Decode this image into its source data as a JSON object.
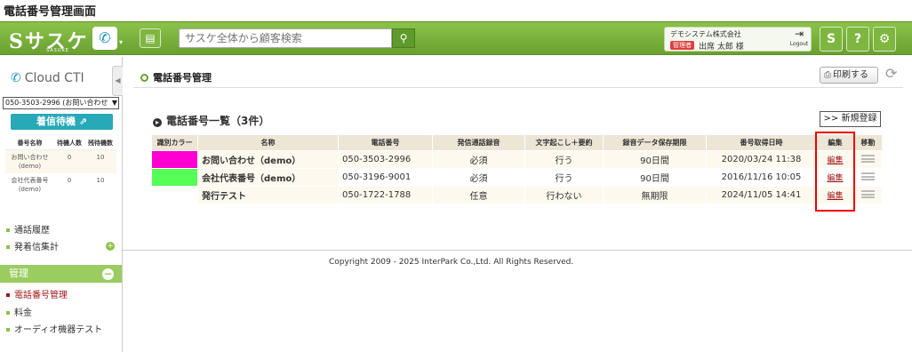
{
  "page_title": "電話番号管理画面",
  "topbar": {
    "logo": "Sサスケ",
    "logo_sub": "SASUKE",
    "phone_icon": "phone-icon",
    "search_placeholder": "サスケ全体から顧客検索",
    "company": "デモシステム株式会社",
    "admin_badge": "管理者",
    "user": "出席 太郎 様",
    "logout_label": "Logout"
  },
  "sidebar": {
    "cti_title": "Cloud CTI",
    "selected_number": "050-3503-2996 (お問い合わせ",
    "wait_button": "着信待機",
    "table_headers": [
      "番号名称",
      "待機人数",
      "残待機数"
    ],
    "rows": [
      {
        "name": "お問い合わせ(demo)",
        "wait": "0",
        "remain": "10"
      },
      {
        "name": "会社代表番号(demo)",
        "wait": "0",
        "remain": "10"
      }
    ],
    "links": [
      "通話履歴",
      "発着信集計"
    ],
    "section_header": "管理",
    "admin_links": [
      "電話番号管理",
      "料金",
      "オーディオ機器テスト"
    ]
  },
  "main": {
    "title": "電話番号管理",
    "print_label": "印刷する",
    "list_title": "電話番号一覧（3件）",
    "new_button": ">> 新規登録",
    "columns": [
      "識別カラー",
      "名称",
      "電話番号",
      "発信通話録音",
      "文字起こし＋要約",
      "録音データ保存期限",
      "番号取得日時",
      "編集",
      "移動"
    ],
    "rows": [
      {
        "color": "#ff00d2",
        "name": "お問い合わせ（demo）",
        "tel": "050-3503-2996",
        "record": "必須",
        "transcribe": "行う",
        "retention": "90日間",
        "acquired": "2020/03/24 11:38",
        "edit": "編集"
      },
      {
        "color": "#55ff55",
        "name": "会社代表番号（demo）",
        "tel": "050-3196-9001",
        "record": "必須",
        "transcribe": "行う",
        "retention": "90日間",
        "acquired": "2016/11/16 10:05",
        "edit": "編集"
      },
      {
        "color": "",
        "name": "発行テスト",
        "tel": "050-1722-1788",
        "record": "任意",
        "transcribe": "行わない",
        "retention": "無期限",
        "acquired": "2024/11/05 14:41",
        "edit": "編集"
      }
    ]
  },
  "footer": {
    "copyright": "Copyright 2009 - 2025 InterPark Co.,Ltd. All Rights Reserved."
  }
}
